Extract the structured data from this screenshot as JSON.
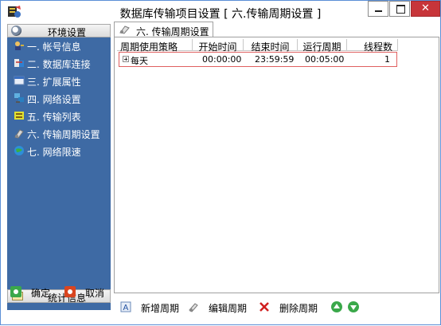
{
  "window": {
    "title": "数据库传输项目设置 [ 六.传输周期设置 ]"
  },
  "sidebar": {
    "section_title": "环境设置",
    "items": [
      {
        "label": "一. 帐号信息",
        "icon": "user-key-icon"
      },
      {
        "label": "二. 数据库连接",
        "icon": "database-link-icon"
      },
      {
        "label": "三. 扩展属性",
        "icon": "properties-icon"
      },
      {
        "label": "四. 网络设置",
        "icon": "network-icon"
      },
      {
        "label": "五. 传输列表",
        "icon": "list-icon"
      },
      {
        "label": "六. 传输周期设置",
        "icon": "schedule-icon"
      },
      {
        "label": "七. 网络限速",
        "icon": "globe-icon"
      }
    ],
    "footer_title": "统计信息"
  },
  "actions": {
    "ok_label": "确定",
    "cancel_label": "取消"
  },
  "tab": {
    "label": "六. 传输周期设置"
  },
  "table": {
    "columns": [
      "周期使用策略",
      "开始时间",
      "结束时间",
      "运行周期",
      "线程数"
    ],
    "rows": [
      {
        "policy": "每天",
        "start": "00:00:00",
        "end": "23:59:59",
        "period": "00:05:00",
        "threads": "1"
      }
    ]
  },
  "toolbar": {
    "add_label": "新增周期",
    "edit_label": "编辑周期",
    "delete_label": "删除周期"
  },
  "colors": {
    "sidebar_bg": "#3e6aa4",
    "close_button": "#c7353a",
    "row_border": "#e06060",
    "accent_green": "#3aa84a"
  }
}
